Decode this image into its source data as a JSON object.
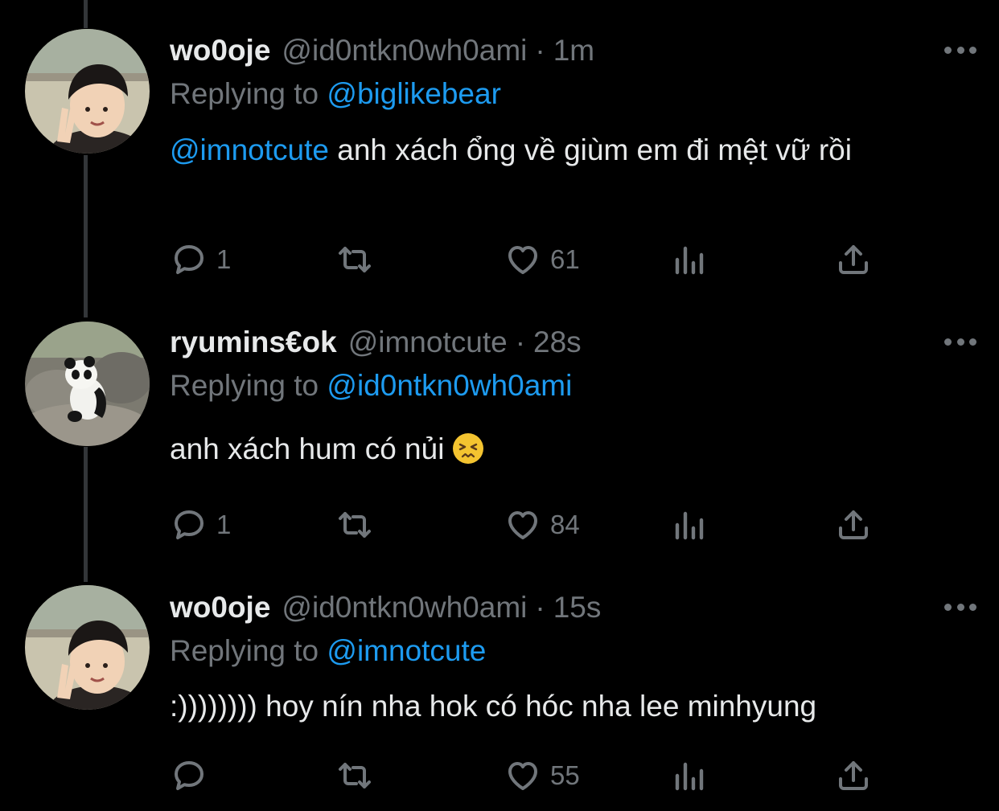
{
  "tweets": [
    {
      "display_name": "wo0oje",
      "handle": "@id0ntkn0wh0ami",
      "separator": "·",
      "time": "1m",
      "replying_prefix": "Replying to",
      "replying_to": "@biglikebear",
      "text_mention": "@imnotcute",
      "text": " anh xách ổng về giùm em đi mệt vữ rồi",
      "replies": "1",
      "retweets": "",
      "likes": "61",
      "avatar": "boy-avatar"
    },
    {
      "display_name": "ryumins€ok",
      "handle": "@imnotcute",
      "separator": "·",
      "time": "28s",
      "replying_prefix": "Replying to",
      "replying_to": "@id0ntkn0wh0ami",
      "text_mention": "",
      "text": "anh xách hum có nủi",
      "emoji": "persevering-face-emoji",
      "replies": "1",
      "retweets": "",
      "likes": "84",
      "avatar": "panda-avatar"
    },
    {
      "display_name": "wo0oje",
      "handle": "@id0ntkn0wh0ami",
      "separator": "·",
      "time": "15s",
      "replying_prefix": "Replying to",
      "replying_to": "@imnotcute",
      "text_mention": "",
      "text": ":)))))))) hoy nín nha hok có hóc nha lee minhyung",
      "replies": "",
      "retweets": "",
      "likes": "55",
      "avatar": "boy-avatar"
    }
  ],
  "icons": [
    "reply-icon",
    "retweet-icon",
    "like-icon",
    "analytics-icon",
    "share-icon",
    "more-icon"
  ],
  "colors": {
    "background": "#000000",
    "text": "#e7e9ea",
    "secondary": "#71767b",
    "link": "#1d9bf0",
    "thread_line": "#333639"
  }
}
